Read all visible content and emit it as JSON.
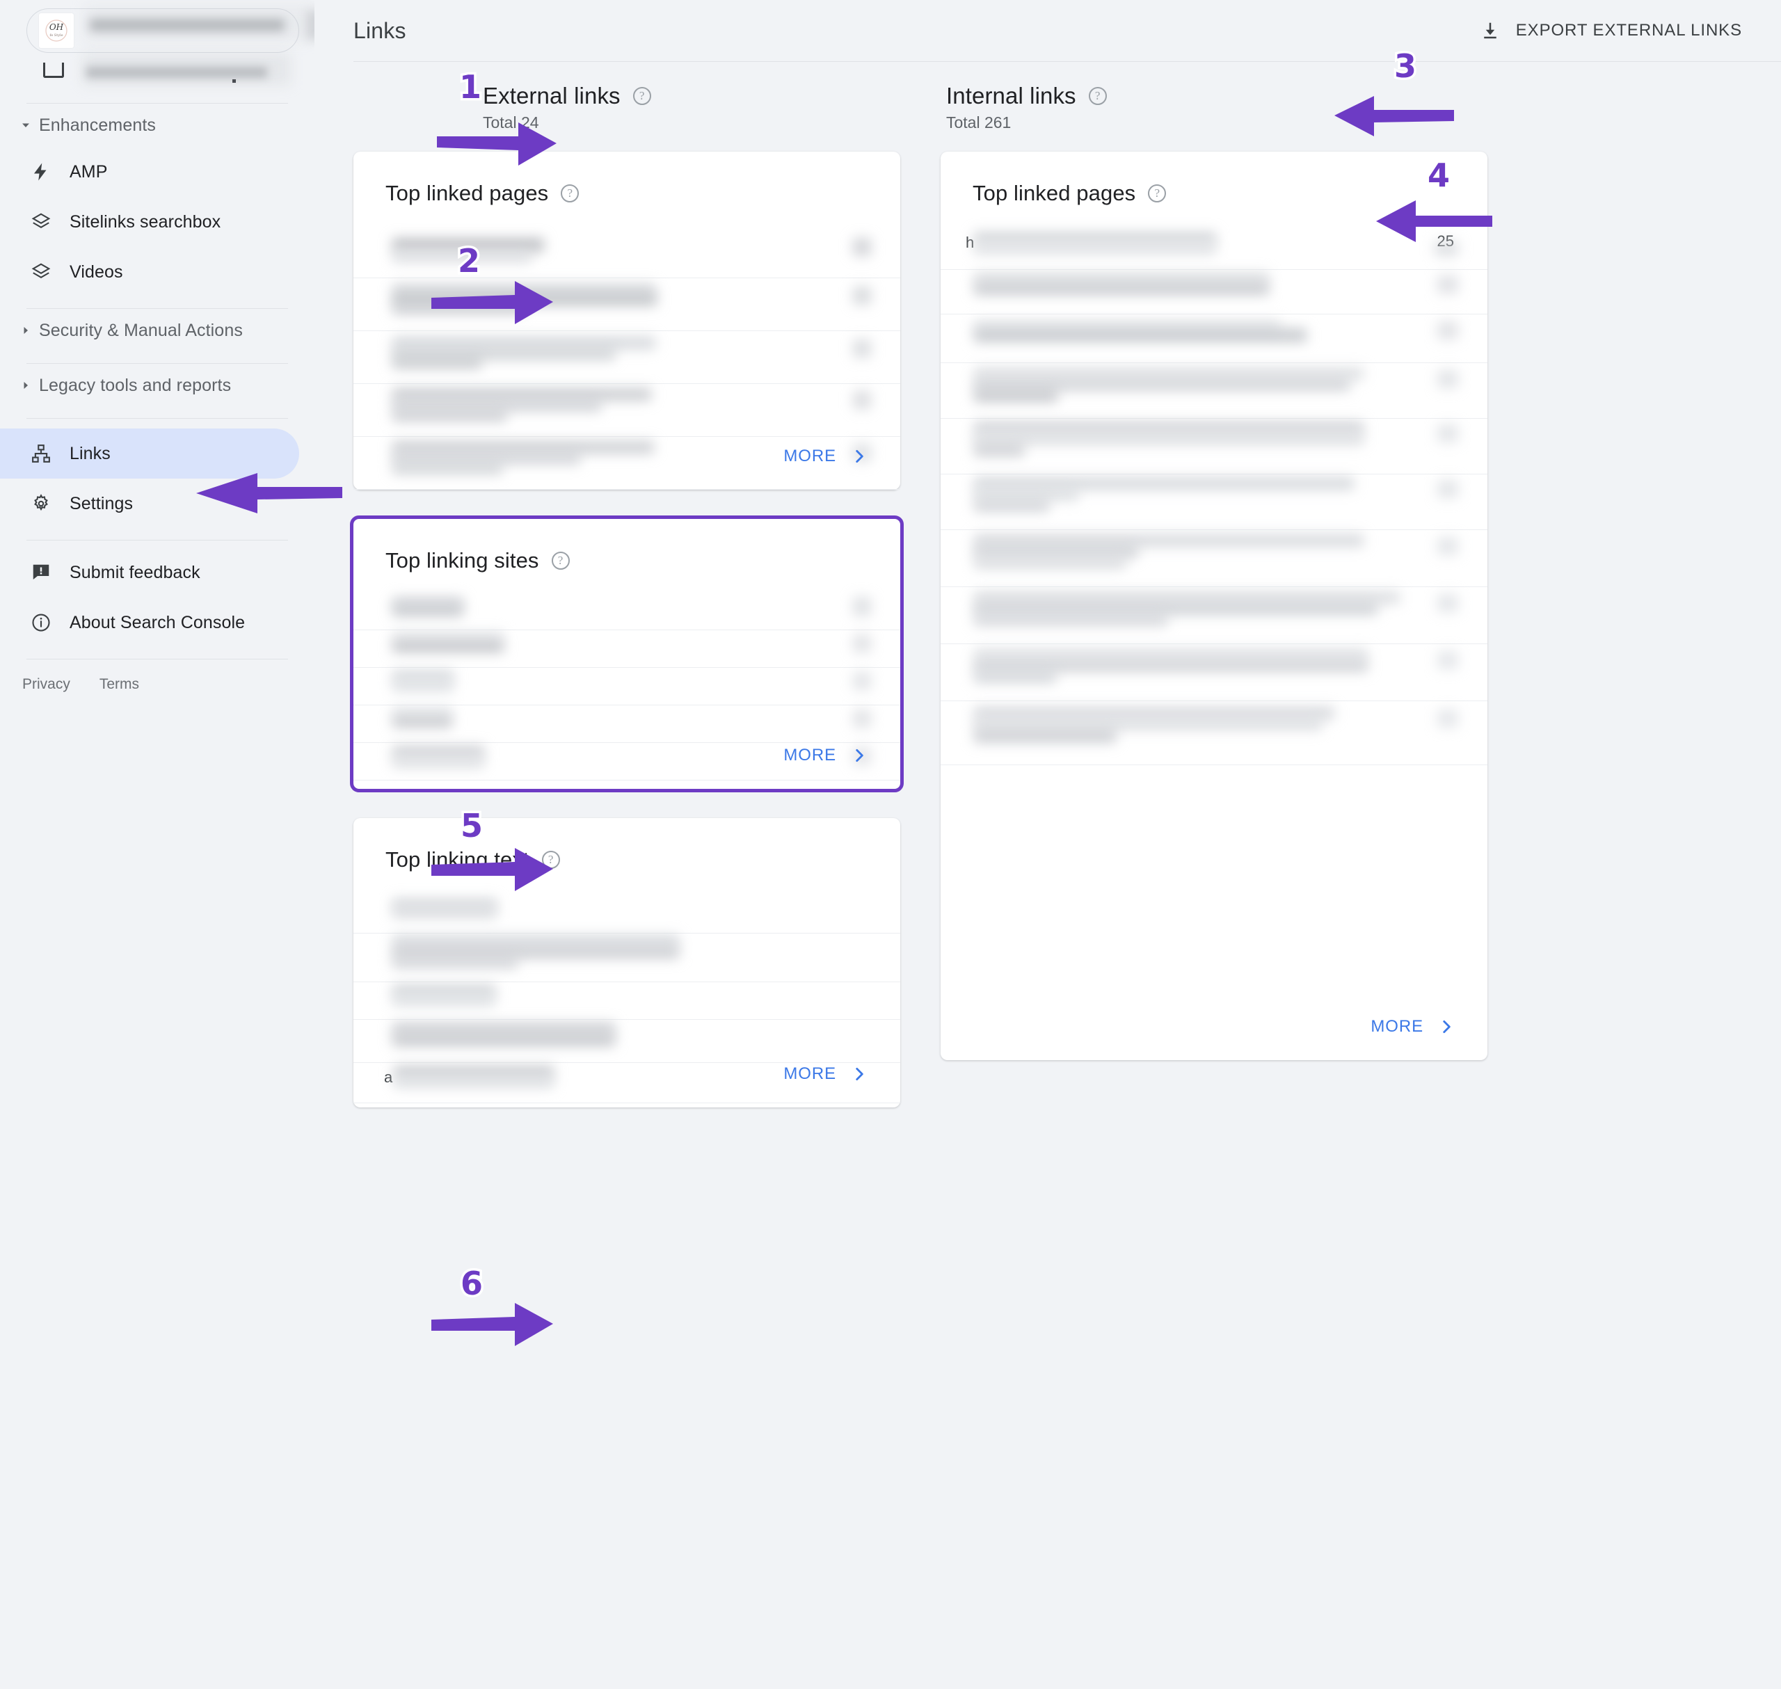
{
  "sidebar": {
    "property": {
      "logo_text": "OH",
      "logo_sub": "fe Style"
    },
    "groups": [
      {
        "label": "Enhancements",
        "expanded": true,
        "caret": "caret-down-icon"
      },
      {
        "label": "Security & Manual Actions",
        "expanded": false,
        "caret": "caret-right-icon"
      },
      {
        "label": "Legacy tools and reports",
        "expanded": false,
        "caret": "caret-right-icon"
      }
    ],
    "enhancement_items": [
      {
        "label": "AMP",
        "icon": "bolt-icon"
      },
      {
        "label": "Sitelinks searchbox",
        "icon": "layers-icon"
      },
      {
        "label": "Videos",
        "icon": "layers-icon"
      }
    ],
    "nav_items": [
      {
        "label": "Links",
        "icon": "links-sitemap-icon",
        "active": true
      },
      {
        "label": "Settings",
        "icon": "gear-icon",
        "active": false
      }
    ],
    "support_items": [
      {
        "label": "Submit feedback",
        "icon": "feedback-icon"
      },
      {
        "label": "About Search Console",
        "icon": "info-icon"
      }
    ],
    "footer": {
      "privacy": "Privacy",
      "terms": "Terms"
    }
  },
  "header": {
    "title": "Links",
    "export_label": "EXPORT EXTERNAL LINKS",
    "export_icon": "download-icon"
  },
  "external": {
    "title": "External links",
    "total": "Total 24",
    "help_icon": "help-circle-icon",
    "cards": [
      {
        "title": "Top linked pages",
        "help_icon": "help-circle-icon",
        "more_label": "MORE",
        "more_icon": "chevron-right-icon",
        "rows": [
          {
            "label_redacted": true,
            "value_redacted": true
          },
          {
            "label_redacted": true,
            "value_redacted": true
          },
          {
            "label_redacted": true,
            "value_redacted": true
          },
          {
            "label_redacted": true,
            "value_redacted": true
          },
          {
            "label_redacted": true,
            "value_redacted": true
          }
        ]
      },
      {
        "title": "Top linking sites",
        "help_icon": "help-circle-icon",
        "more_label": "MORE",
        "more_icon": "chevron-right-icon",
        "highlighted": true,
        "rows": [
          {
            "label_redacted": true,
            "value_redacted": true
          },
          {
            "label_redacted": true,
            "value_redacted": true
          },
          {
            "label_redacted": true,
            "value_redacted": true
          },
          {
            "label_redacted": true,
            "value_redacted": true
          },
          {
            "label_redacted": true,
            "value_redacted": true
          }
        ]
      },
      {
        "title": "Top linking text",
        "help_icon": "help-circle-icon",
        "more_label": "MORE",
        "more_icon": "chevron-right-icon",
        "rows": [
          {
            "label_redacted": true,
            "value_redacted": true
          },
          {
            "label_redacted": true,
            "value_redacted": true
          },
          {
            "label_redacted": true,
            "value_redacted": true
          },
          {
            "label_redacted": true,
            "value_redacted": true
          },
          {
            "label_redacted": true,
            "value_redacted": true,
            "leading_char": "a"
          }
        ]
      }
    ]
  },
  "internal": {
    "title": "Internal links",
    "total": "Total 261",
    "help_icon": "help-circle-icon",
    "cards": [
      {
        "title": "Top linked pages",
        "help_icon": "help-circle-icon",
        "more_label": "MORE",
        "more_icon": "chevron-right-icon",
        "rows": [
          {
            "label_redacted": true,
            "value": "25",
            "leading_char": "h"
          },
          {
            "label_redacted": true,
            "value_redacted": true
          },
          {
            "label_redacted": true,
            "value_redacted": true
          },
          {
            "label_redacted": true,
            "value_redacted": true
          },
          {
            "label_redacted": true,
            "value_redacted": true
          },
          {
            "label_redacted": true,
            "value_redacted": true
          },
          {
            "label_redacted": true,
            "value_redacted": true
          },
          {
            "label_redacted": true,
            "value_redacted": true
          },
          {
            "label_redacted": true,
            "value_redacted": true
          },
          {
            "label_redacted": true,
            "value_redacted": true
          }
        ]
      }
    ]
  },
  "annotations": {
    "accent_color": "#6d3bc4",
    "markers": [
      {
        "number": "1",
        "target": "external-links-section-title"
      },
      {
        "number": "2",
        "target": "external-top-linked-pages-card"
      },
      {
        "number": "3",
        "target": "internal-links-section-title"
      },
      {
        "number": "4",
        "target": "internal-top-linked-pages-card"
      },
      {
        "number": "5",
        "target": "top-linking-sites-card"
      },
      {
        "number": "6",
        "target": "top-linking-text-card"
      }
    ]
  },
  "colors": {
    "page_bg": "#f1f3f6",
    "card_bg": "#ffffff",
    "accent_purple": "#6d3bc4",
    "link_blue": "#3b78e7",
    "active_nav_bg": "#d9e3fb",
    "text_primary": "#202124",
    "text_secondary": "#5f6368"
  }
}
